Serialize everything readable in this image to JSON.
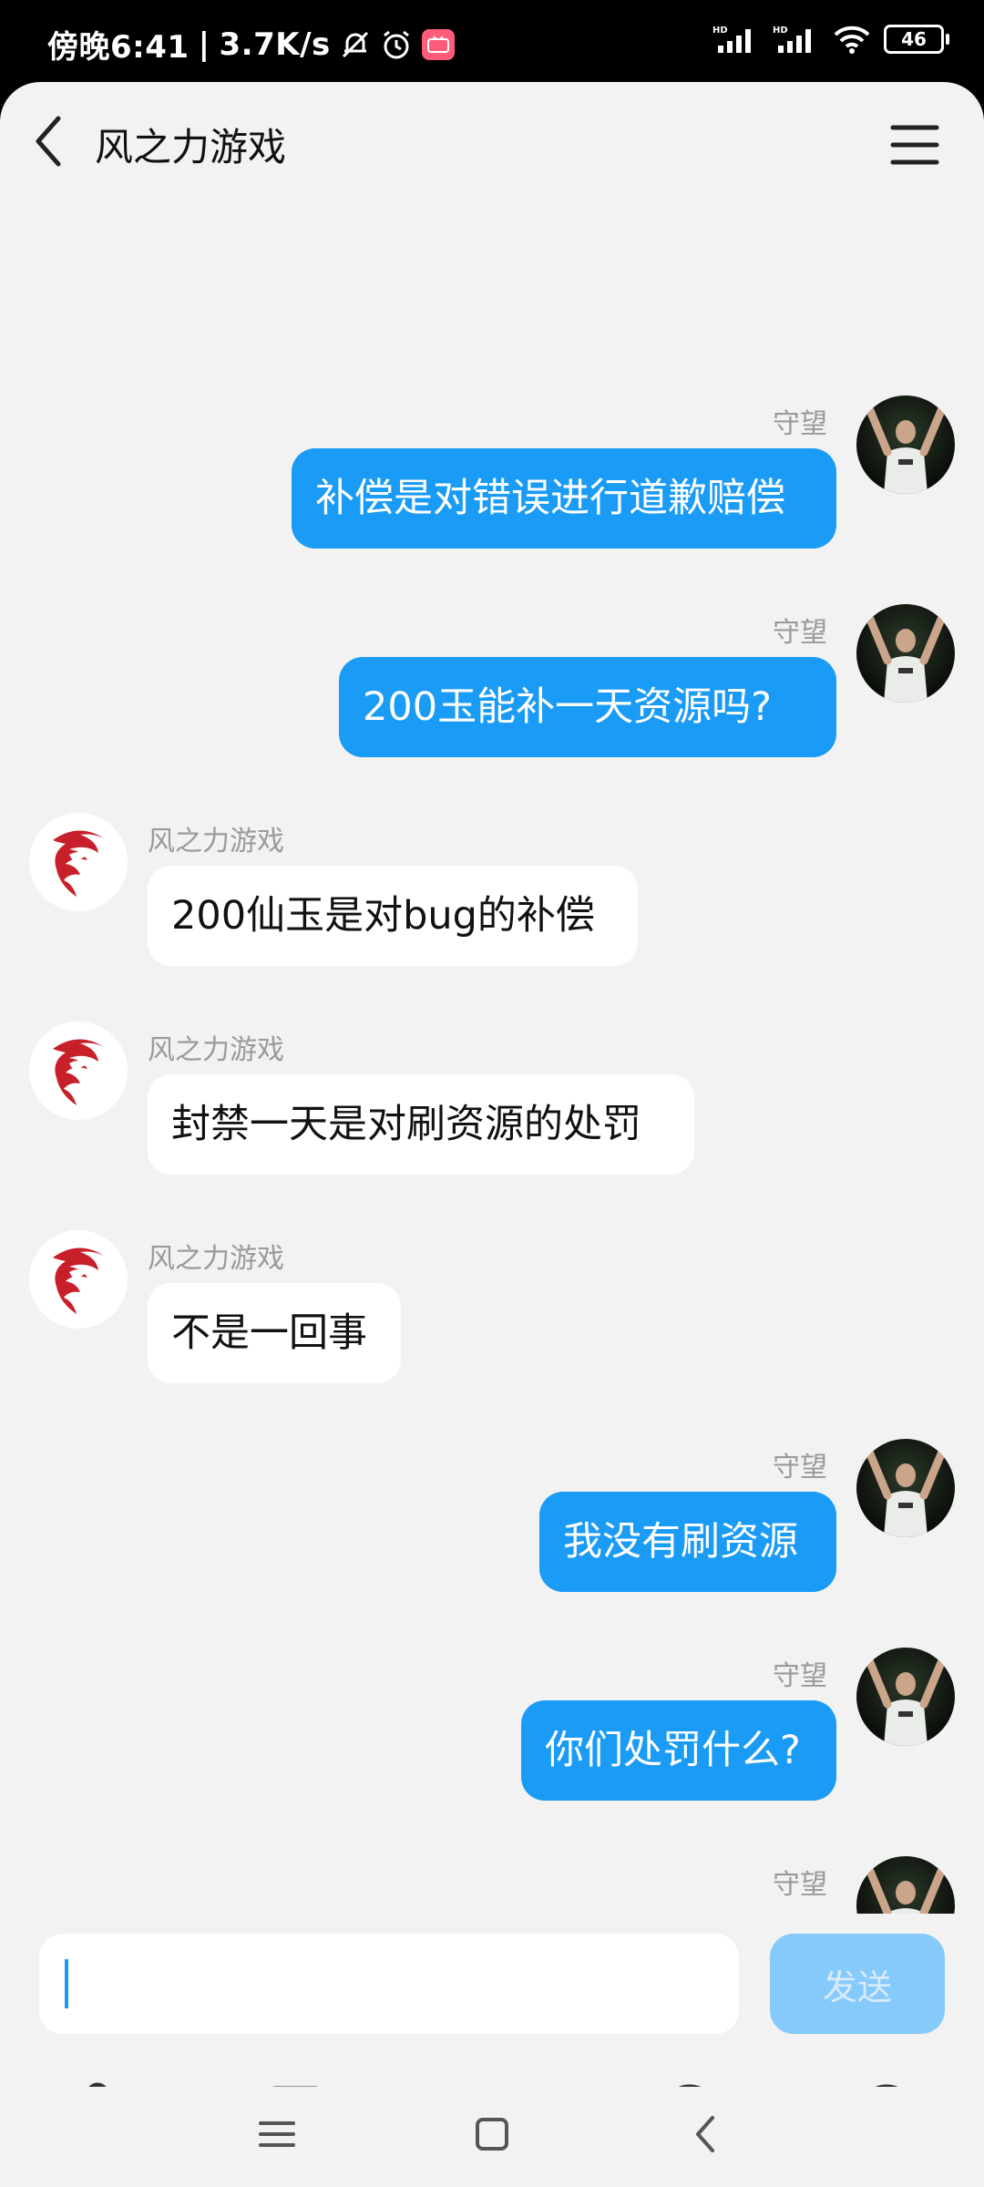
{
  "status_bar": {
    "time": "傍晚6:41",
    "separator": "|",
    "speed": "3.7K/s",
    "icons": [
      "mute-bell-icon",
      "alarm-icon",
      "bilibili-icon",
      "hd-signal-icon",
      "wifi-icon"
    ],
    "battery": "46"
  },
  "header": {
    "title": "风之力游戏",
    "back_icon": "chevron-left-icon",
    "menu_icon": "hamburger-menu-icon"
  },
  "messages": [
    {
      "side": "me",
      "sender": "守望",
      "text": "补偿是对错误进行道歉赔偿"
    },
    {
      "side": "me",
      "sender": "守望",
      "text": "200玉能补一天资源吗?"
    },
    {
      "side": "bot",
      "sender": "风之力游戏",
      "text": "200仙玉是对bug的补偿"
    },
    {
      "side": "bot",
      "sender": "风之力游戏",
      "text": "封禁一天是对刷资源的处罚"
    },
    {
      "side": "bot",
      "sender": "风之力游戏",
      "text": "不是一回事"
    },
    {
      "side": "me",
      "sender": "守望",
      "text": "我没有刷资源"
    },
    {
      "side": "me",
      "sender": "守望",
      "text": "你们处罚什么?"
    },
    {
      "side": "me",
      "sender": "守望",
      "text": ""
    }
  ],
  "composer": {
    "input_value": "",
    "send_label": "发送",
    "tools": [
      "microphone-icon",
      "image-icon",
      "camera-icon",
      "emoji-icon",
      "plus-icon"
    ]
  },
  "colors": {
    "accent": "#1a9bf5",
    "bot_logo": "#c8202a",
    "background": "#f2f2f2"
  }
}
